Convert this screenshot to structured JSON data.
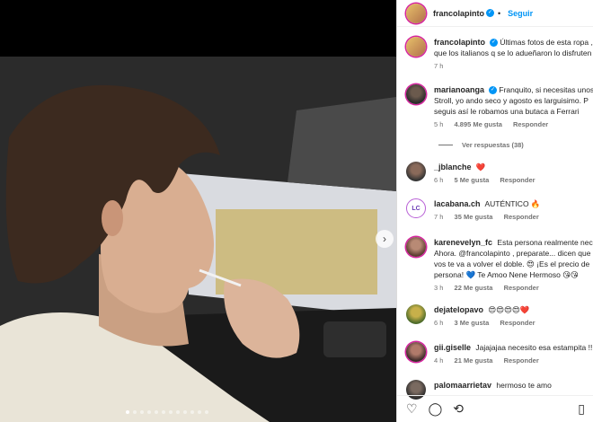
{
  "post": {
    "author": "francolapinto",
    "follow_label": "Seguir",
    "caption_text": "Últimas fotos de esta ropa , que los italianos q se lo adueñaron lo disfruten",
    "caption_line1": "Últimas fotos de esta ropa ,",
    "caption_line2": "que los italianos q se lo adueñaron lo disfruten",
    "caption_time": "7 h"
  },
  "comments": [
    {
      "user": "marianoanga",
      "verified": true,
      "lines": [
        "Franquito, si necesitas unos",
        "Stroll, yo ando seco y agosto es larguisimo. P",
        "seguis así le robamos una butaca a Ferrari"
      ],
      "time": "5 h",
      "likes": "4.895 Me gusta",
      "reply": "Responder",
      "view_replies": "Ver respuestas (38)"
    },
    {
      "user": "_jblanche",
      "lines": [
        "❤️"
      ],
      "time": "6 h",
      "likes": "5 Me gusta",
      "reply": "Responder"
    },
    {
      "user": "lacabana.ch",
      "lines": [
        "AUTÉNTICO 🔥"
      ],
      "time": "7 h",
      "likes": "35 Me gusta",
      "reply": "Responder"
    },
    {
      "user": "karenevelyn_fc",
      "lines": [
        "Esta persona realmente neces",
        "Ahora. @francolapinto , preparate... dicen que",
        "vos te va a volver el doble. 😍 ¡Es el precio de",
        "persona! 💙 Te Amoo Nene Hermoso 😘😘"
      ],
      "mention": "@francolapinto",
      "time": "3 h",
      "likes": "22 Me gusta",
      "reply": "Responder"
    },
    {
      "user": "dejatelopavo",
      "lines": [
        "😍😍😍😍❤️"
      ],
      "time": "6 h",
      "likes": "3 Me gusta",
      "reply": "Responder"
    },
    {
      "user": "gii.giselle",
      "lines": [
        "Jajajajaa necesito esa estampita !!!!"
      ],
      "time": "4 h",
      "likes": "21 Me gusta",
      "reply": "Responder"
    },
    {
      "user": "palomaarrietav",
      "lines": [
        "hermoso te amo"
      ]
    }
  ],
  "icons": {
    "heart": "heart-icon",
    "comment": "comment-icon",
    "share": "share-icon",
    "save": "bookmark-icon",
    "next": "chevron-right-icon"
  },
  "colors": {
    "accent": "#0095f6",
    "text": "#262626",
    "meta": "#737373"
  }
}
